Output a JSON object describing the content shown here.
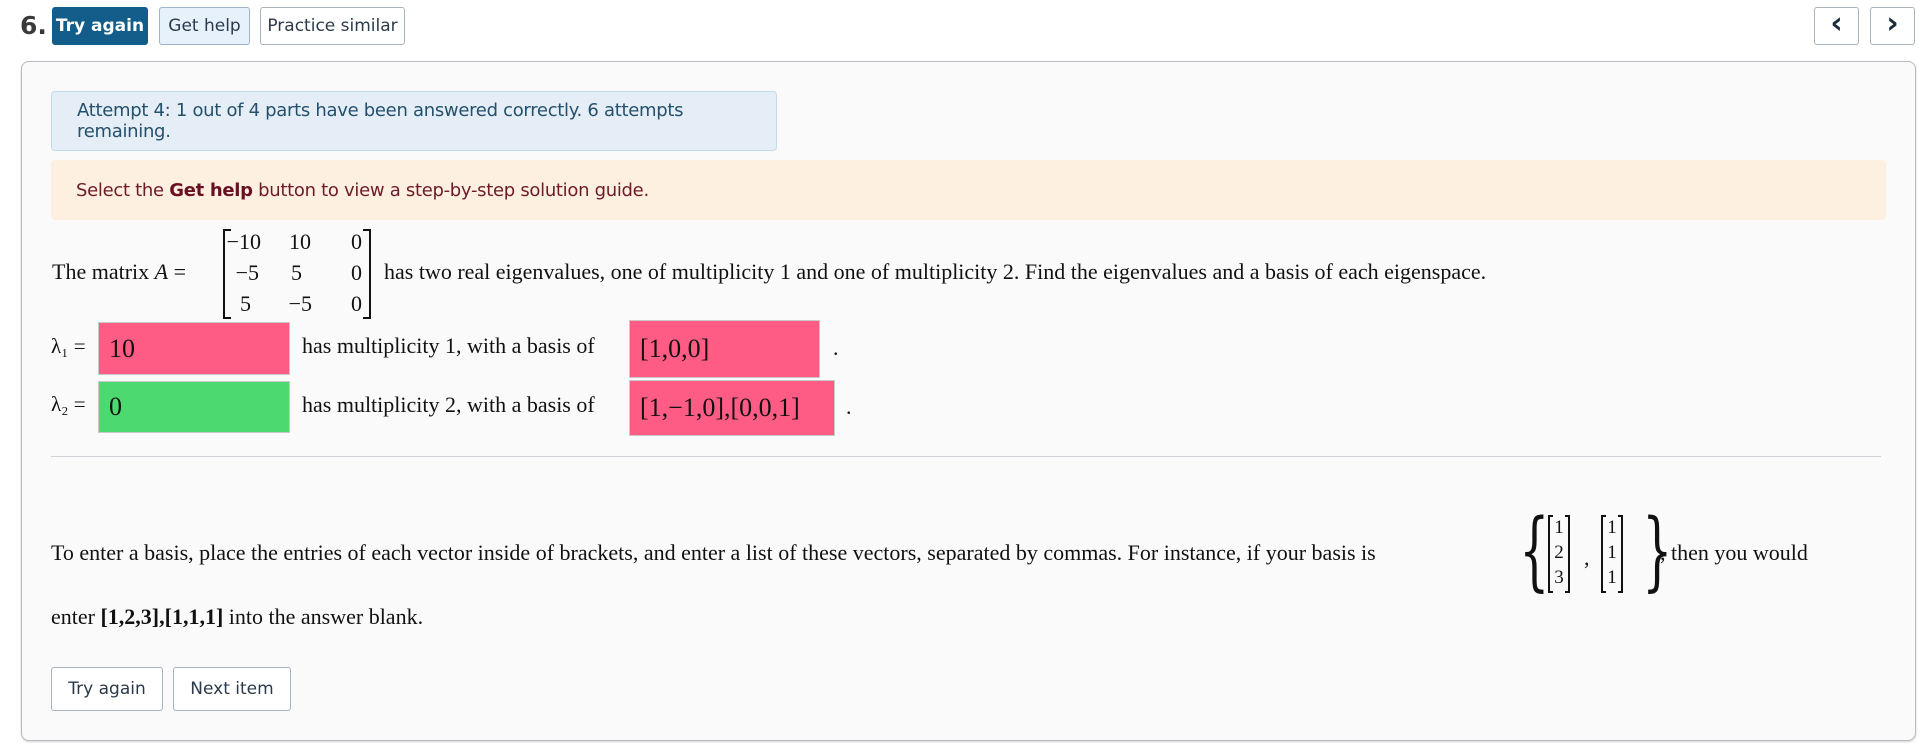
{
  "header": {
    "question_number": "6.",
    "try_again_label": "Try again",
    "get_help_label": "Get help",
    "practice_similar_label": "Practice similar",
    "prev_icon": "chevron-left-icon",
    "next_icon": "chevron-right-icon",
    "prev_glyph": "‹",
    "next_glyph": "›"
  },
  "alerts": {
    "attempt_status": "Attempt 4: 1 out of 4 parts have been answered correctly. 6 attempts remaining.",
    "help_prefix": "Select the ",
    "help_bold": "Get help",
    "help_suffix": " button to view a step-by-step solution guide."
  },
  "question": {
    "intro": "The matrix ",
    "matrix_var": "A",
    "equals": " =",
    "matrix": [
      [
        "−10",
        "10",
        "0"
      ],
      [
        "−5",
        "5",
        "0"
      ],
      [
        "5",
        "−5",
        "0"
      ]
    ],
    "statement": "has two real eigenvalues, one of multiplicity 1 and one of multiplicity 2. Find the eigenvalues and a basis of each eigenspace."
  },
  "answers": [
    {
      "label": "λ₁ =",
      "eigenvalue": "10",
      "eigenvalue_status": "incorrect",
      "middle_text": "has multiplicity 1, with a basis of",
      "basis": "[1,0,0]",
      "basis_status": "incorrect",
      "end": "."
    },
    {
      "label": "λ₂ =",
      "eigenvalue": "0",
      "eigenvalue_status": "correct",
      "middle_text": "has multiplicity 2, with a basis of",
      "basis": "[1,−1,0],[0,0,1]",
      "basis_status": "incorrect",
      "end": "."
    }
  ],
  "status_colors": {
    "incorrect": "#ff5c85",
    "correct": "#4cd96f"
  },
  "instructions": {
    "line1": "To enter a basis, place the entries of each vector inside of brackets, and enter a list of these vectors, separated by commas. For instance, if your basis is",
    "example_vectors": [
      [
        "1",
        "2",
        "3"
      ],
      [
        "1",
        "1",
        "1"
      ]
    ],
    "line1_end": ", then you would",
    "line2_prefix": "enter ",
    "line2_example": "[1,2,3],[1,1,1]",
    "line2_suffix": " into the answer blank."
  },
  "footer": {
    "try_again_label": "Try again",
    "next_item_label": "Next item"
  }
}
